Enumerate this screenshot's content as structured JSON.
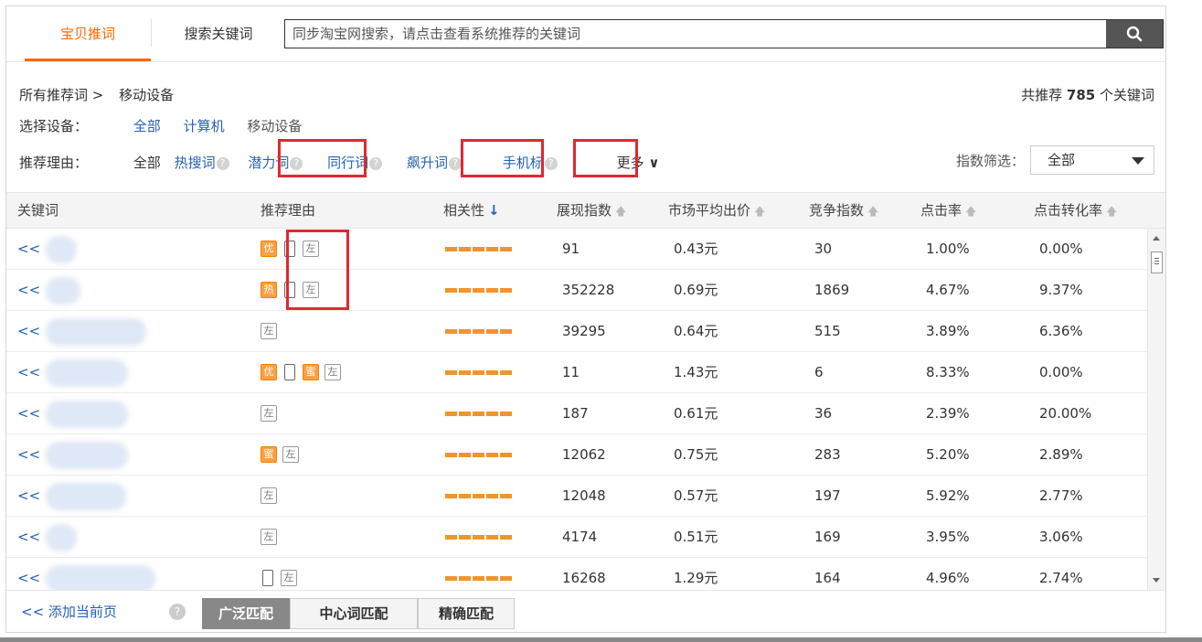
{
  "tabs": {
    "active": "宝贝推词",
    "other": "搜索关键词"
  },
  "search": {
    "placeholder": "同步淘宝网搜索，请点击查看系统推荐的关键词"
  },
  "breadcrumb": {
    "root": "所有推荐词 >",
    "current": "移动设备"
  },
  "total": {
    "prefix": "共推荐",
    "count": "785",
    "suffix": "个关键词"
  },
  "device": {
    "label": "选择设备：",
    "options": [
      "全部",
      "计算机",
      "移动设备"
    ]
  },
  "reason": {
    "label": "推荐理由：",
    "all": "全部",
    "hot": "热搜词",
    "potential": "潜力词",
    "peer": "同行词",
    "soaring": "飙升词",
    "mobile": "手机标",
    "more": "更多"
  },
  "index_filter": {
    "label": "指数筛选：",
    "value": "全部"
  },
  "columns": [
    "关键词",
    "推荐理由",
    "相关性",
    "展现指数",
    "市场平均出价",
    "竞争指数",
    "点击率",
    "点击转化率"
  ],
  "kw_prefix": "<<",
  "tags": {
    "you": "优",
    "re": "热",
    "zuo": "左",
    "mi": "蜜"
  },
  "rows": [
    {
      "impressions": "91",
      "avg_bid": "0.43元",
      "competition": "30",
      "ctr": "1.00%",
      "cvr": "0.00%"
    },
    {
      "impressions": "352228",
      "avg_bid": "0.69元",
      "competition": "1869",
      "ctr": "4.67%",
      "cvr": "9.37%"
    },
    {
      "impressions": "39295",
      "avg_bid": "0.64元",
      "competition": "515",
      "ctr": "3.89%",
      "cvr": "6.36%"
    },
    {
      "impressions": "11",
      "avg_bid": "1.43元",
      "competition": "6",
      "ctr": "8.33%",
      "cvr": "0.00%"
    },
    {
      "impressions": "187",
      "avg_bid": "0.61元",
      "competition": "36",
      "ctr": "2.39%",
      "cvr": "20.00%"
    },
    {
      "impressions": "12062",
      "avg_bid": "0.75元",
      "competition": "283",
      "ctr": "5.20%",
      "cvr": "2.89%"
    },
    {
      "impressions": "12048",
      "avg_bid": "0.57元",
      "competition": "197",
      "ctr": "5.92%",
      "cvr": "2.77%"
    },
    {
      "impressions": "4174",
      "avg_bid": "0.51元",
      "competition": "169",
      "ctr": "3.95%",
      "cvr": "3.06%"
    },
    {
      "impressions": "16268",
      "avg_bid": "1.29元",
      "competition": "164",
      "ctr": "4.96%",
      "cvr": "2.74%"
    }
  ],
  "footer": {
    "add": "<< 添加当前页",
    "broad": "广泛匹配",
    "center": "中心词匹配",
    "exact": "精确匹配"
  },
  "colors": {
    "accent": "#ff6600",
    "link": "#2562b3",
    "highlight_box": "#e0282f",
    "relevance_bar": "#f29528"
  }
}
